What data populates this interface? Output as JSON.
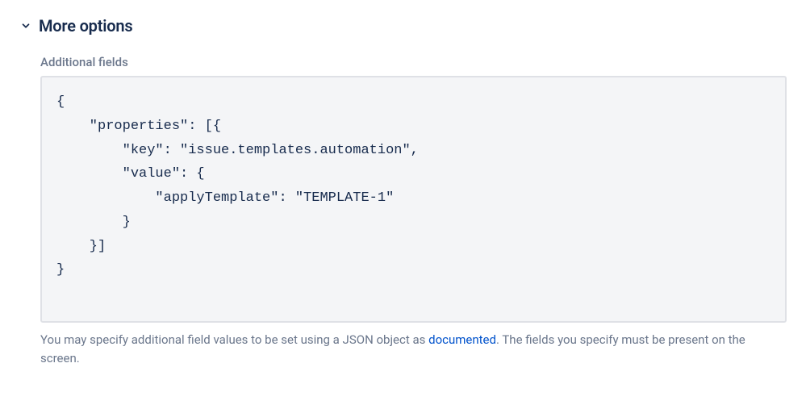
{
  "section": {
    "title": "More options",
    "expanded": true
  },
  "fields": {
    "additional_fields": {
      "label": "Additional fields",
      "value": "{\n    \"properties\": [{\n        \"key\": \"issue.templates.automation\",\n        \"value\": {\n            \"applyTemplate\": \"TEMPLATE-1\"\n        }\n    }]\n}",
      "help_text_before": "You may specify additional field values to be set using a JSON object as ",
      "help_link_text": "documented",
      "help_text_after": ". The fields you specify must be present on the screen."
    }
  }
}
